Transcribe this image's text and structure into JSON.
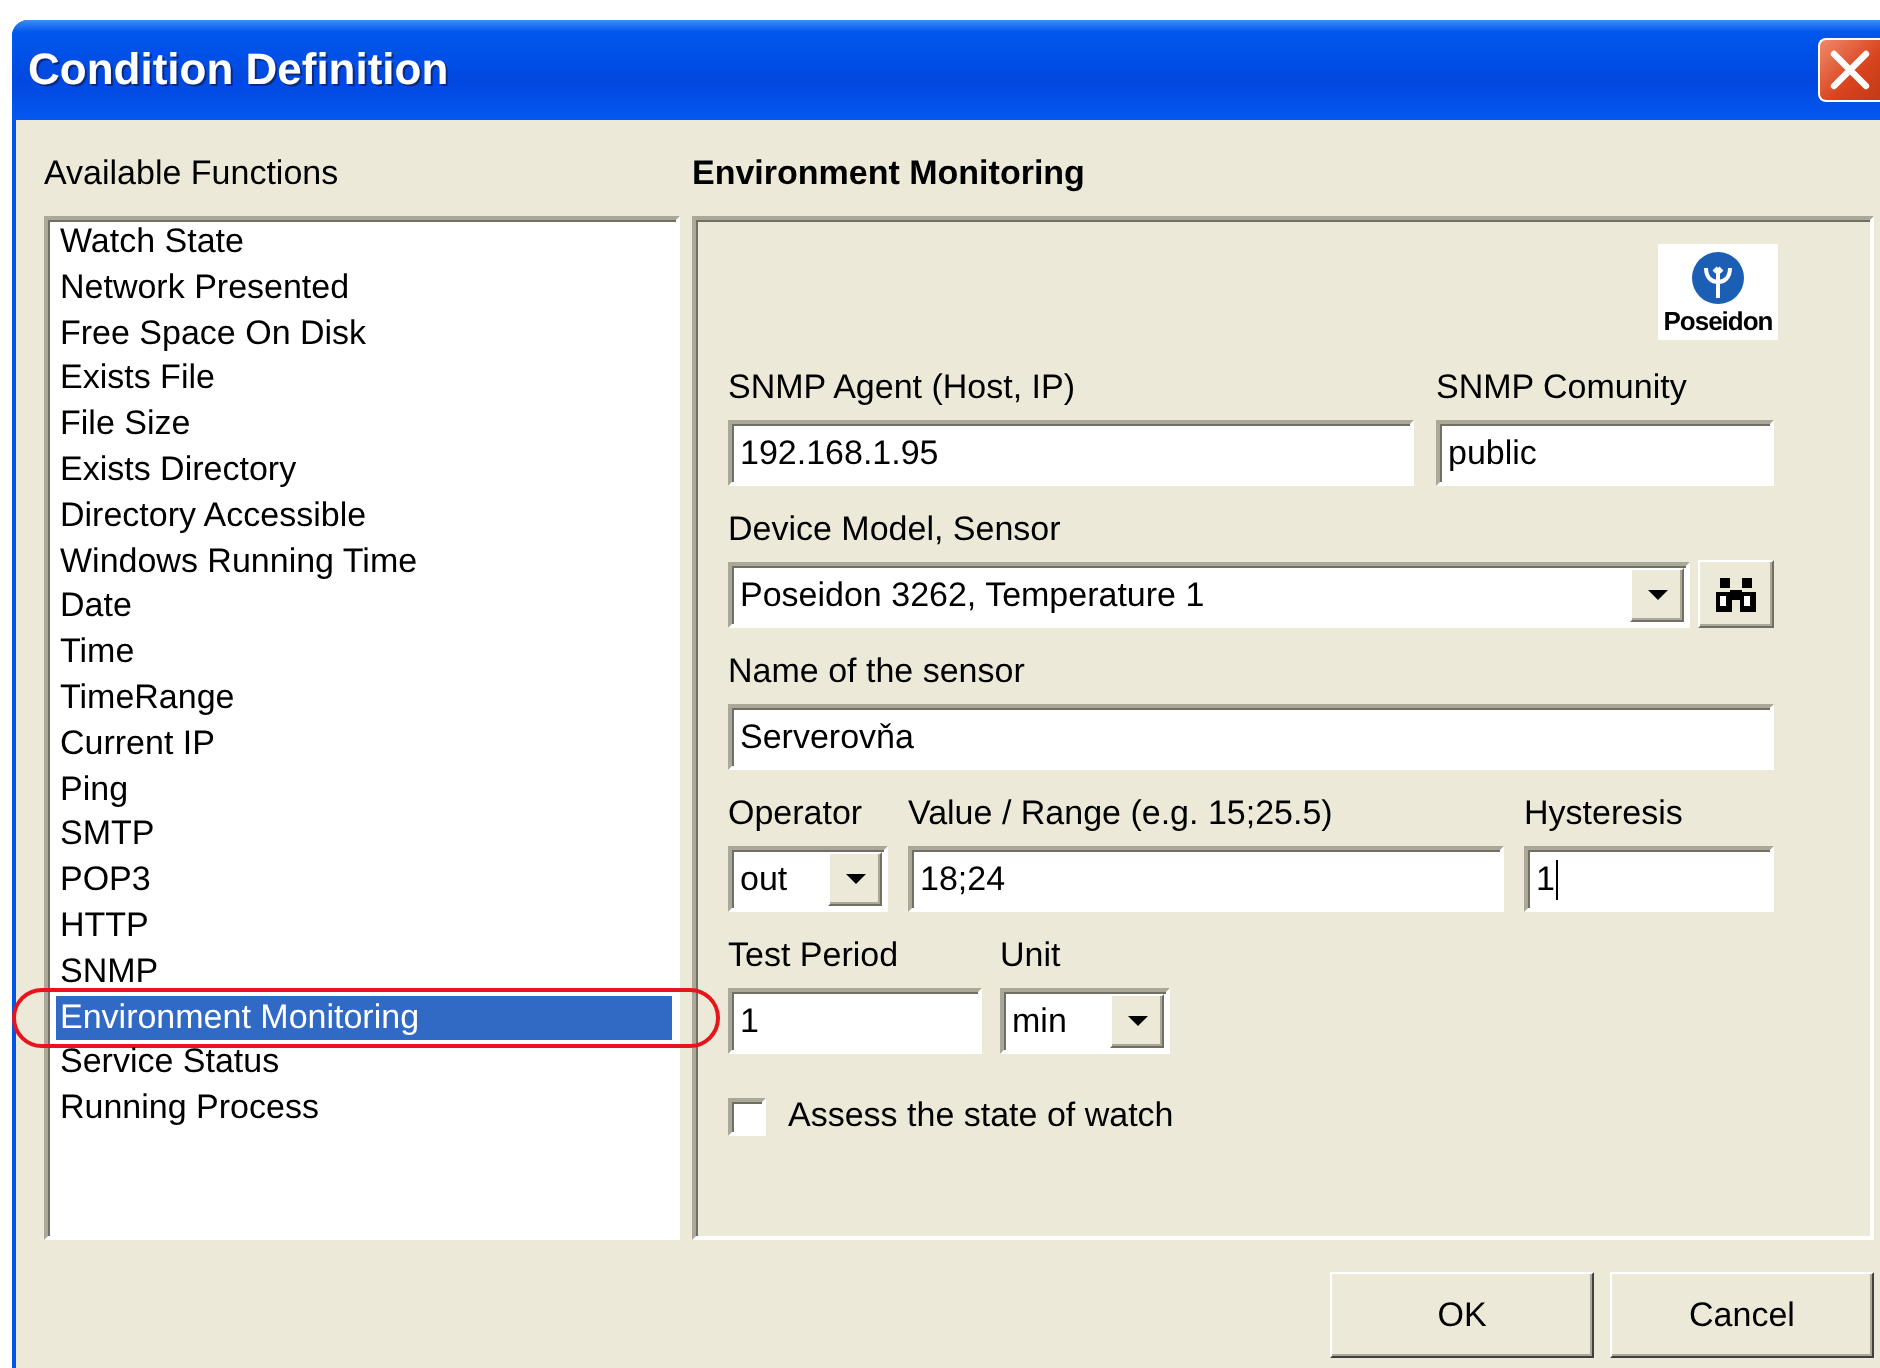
{
  "window": {
    "title": "Condition Definition"
  },
  "functions": {
    "label": "Available Functions",
    "items": [
      {
        "label": "Watch State",
        "selected": false,
        "circled": false
      },
      {
        "label": "Network Presented",
        "selected": false,
        "circled": false
      },
      {
        "label": "Free Space On Disk",
        "selected": false,
        "circled": false
      },
      {
        "label": "Exists File",
        "selected": false,
        "circled": false
      },
      {
        "label": "File Size",
        "selected": false,
        "circled": false
      },
      {
        "label": "Exists Directory",
        "selected": false,
        "circled": false
      },
      {
        "label": "Directory Accessible",
        "selected": false,
        "circled": false
      },
      {
        "label": "Windows Running Time",
        "selected": false,
        "circled": false
      },
      {
        "label": "Date",
        "selected": false,
        "circled": false
      },
      {
        "label": "Time",
        "selected": false,
        "circled": false
      },
      {
        "label": "TimeRange",
        "selected": false,
        "circled": false
      },
      {
        "label": "Current IP",
        "selected": false,
        "circled": false
      },
      {
        "label": "Ping",
        "selected": false,
        "circled": false
      },
      {
        "label": "SMTP",
        "selected": false,
        "circled": false
      },
      {
        "label": "POP3",
        "selected": false,
        "circled": false
      },
      {
        "label": "HTTP",
        "selected": false,
        "circled": false
      },
      {
        "label": "SNMP",
        "selected": false,
        "circled": false
      },
      {
        "label": "Environment Monitoring",
        "selected": true,
        "circled": true
      },
      {
        "label": "Service Status",
        "selected": false,
        "circled": false
      },
      {
        "label": "Running Process",
        "selected": false,
        "circled": false
      }
    ]
  },
  "panel": {
    "title": "Environment Monitoring",
    "logo_text": "Poseidon",
    "fields": [
      {
        "kind": "text",
        "label": "SNMP Agent (Host, IP)",
        "value": "192.168.1.95",
        "focused": false
      },
      {
        "kind": "text",
        "label": "SNMP Comunity",
        "value": "public",
        "focused": false
      },
      {
        "kind": "combo",
        "label": "Device Model, Sensor",
        "value": "Poseidon 3262, Temperature 1"
      },
      {
        "kind": "search_button"
      },
      {
        "kind": "text",
        "label": "Name of the sensor",
        "value": "Serverovňa",
        "focused": false
      },
      {
        "kind": "combo",
        "label": "Operator",
        "value": "out"
      },
      {
        "kind": "text",
        "label": "Value / Range (e.g. 15;25.5)",
        "value": "18;24",
        "focused": false
      },
      {
        "kind": "text",
        "label": "Hysteresis",
        "value": "1",
        "focused": true
      },
      {
        "kind": "text",
        "label": "Test Period",
        "value": "1",
        "focused": false
      },
      {
        "kind": "combo",
        "label": "Unit",
        "value": "min"
      }
    ],
    "checkbox": {
      "label": "Assess the state of watch",
      "checked": false
    }
  },
  "buttons": [
    "OK",
    "Cancel"
  ]
}
